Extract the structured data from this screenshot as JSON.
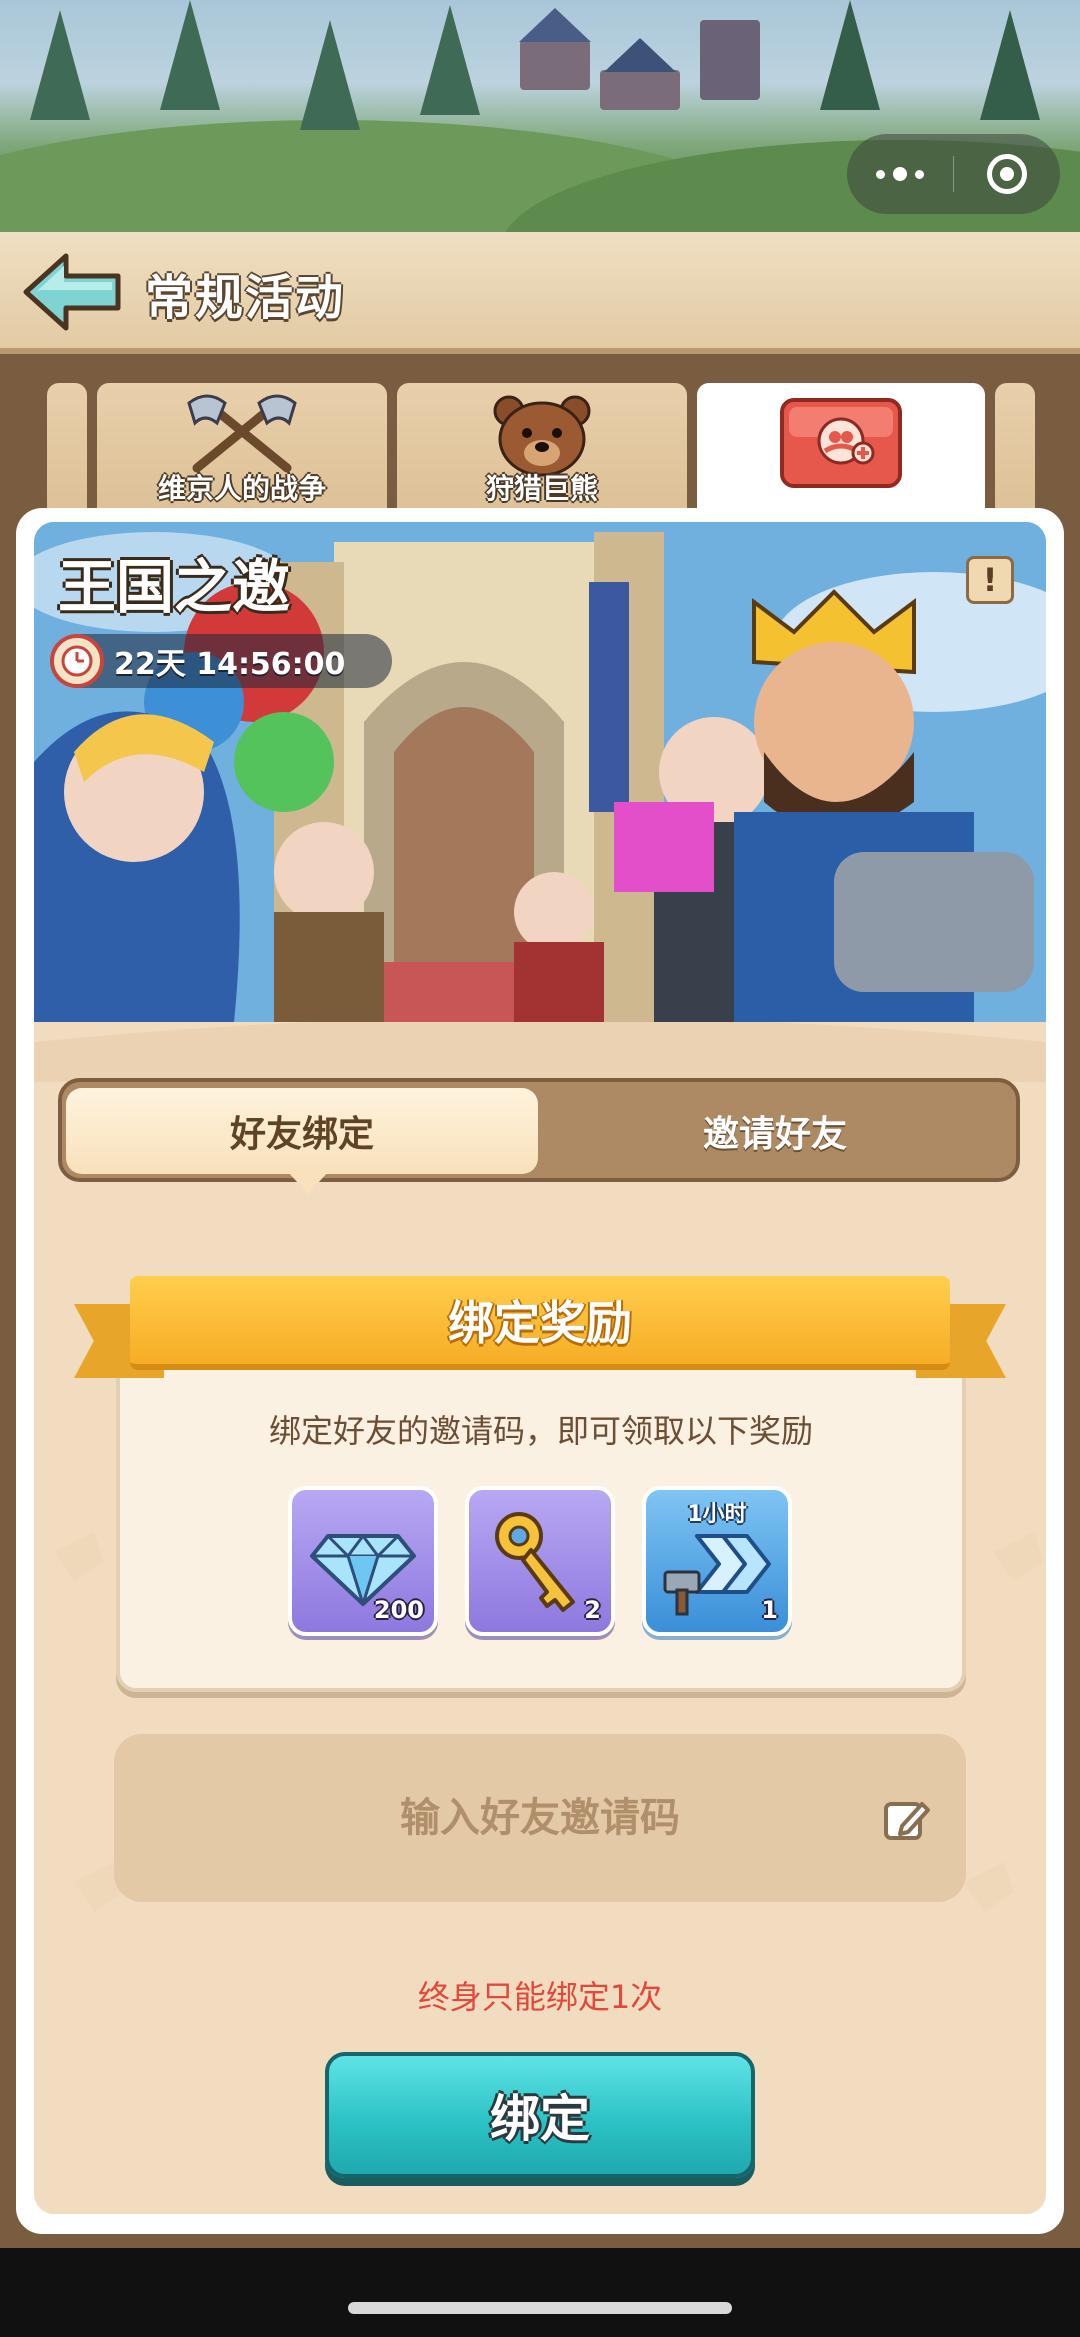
{
  "header": {
    "title": "常规活动"
  },
  "tabs": [
    {
      "label": "维京人的战争",
      "icon": "crossed-axes-icon"
    },
    {
      "label": "狩猎巨熊",
      "icon": "bear-icon"
    },
    {
      "label": "",
      "icon": "invite-friend-icon"
    }
  ],
  "banner": {
    "title": "王国之邀",
    "timer": "22天 14:56:00"
  },
  "segment": {
    "active": "好友绑定",
    "inactive": "邀请好友"
  },
  "reward": {
    "title": "绑定奖励",
    "description": "绑定好友的邀请码，即可领取以下奖励",
    "items": [
      {
        "icon": "gem-icon",
        "count": "200",
        "top_label": ""
      },
      {
        "icon": "key-icon",
        "count": "2",
        "top_label": ""
      },
      {
        "icon": "speedup-hammer-icon",
        "count": "1",
        "top_label": "1小时"
      }
    ]
  },
  "input": {
    "placeholder": "输入好友邀请码",
    "value": ""
  },
  "limit_note": "终身只能绑定1次",
  "bind_button": "绑定",
  "colors": {
    "accent": "#2cc3c6",
    "warning": "#e2483b",
    "ribbon": "#f6ad25"
  }
}
